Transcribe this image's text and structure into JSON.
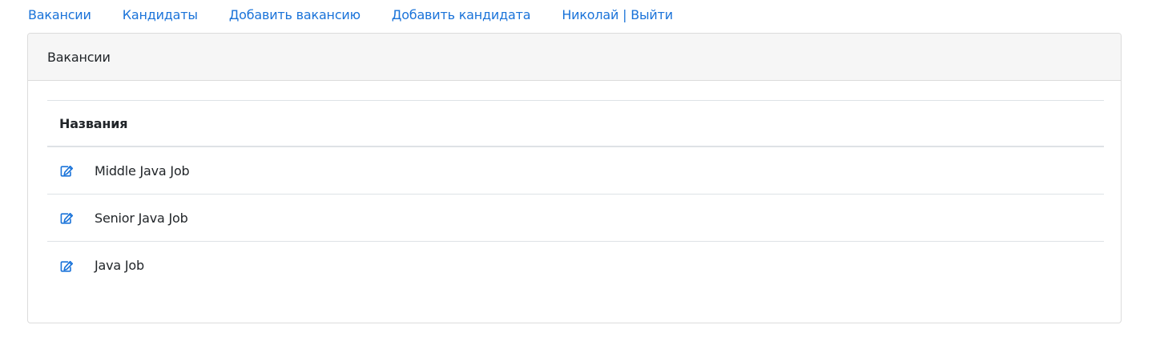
{
  "nav": {
    "items": [
      {
        "label": "Вакансии"
      },
      {
        "label": "Кандидаты"
      },
      {
        "label": "Добавить вакансию"
      },
      {
        "label": "Добавить кандидата"
      },
      {
        "label": "Николай | Выйти"
      }
    ]
  },
  "card": {
    "header": "Вакансии",
    "table": {
      "column_header": "Названия",
      "rows": [
        {
          "title": "Middle Java Job",
          "icon": "edit-icon"
        },
        {
          "title": "Senior Java Job",
          "icon": "edit-icon"
        },
        {
          "title": "Java Job",
          "icon": "edit-icon"
        }
      ]
    }
  },
  "colors": {
    "link": "#1a73d9",
    "header_bg": "#f6f6f6",
    "border": "#dee2e6"
  }
}
